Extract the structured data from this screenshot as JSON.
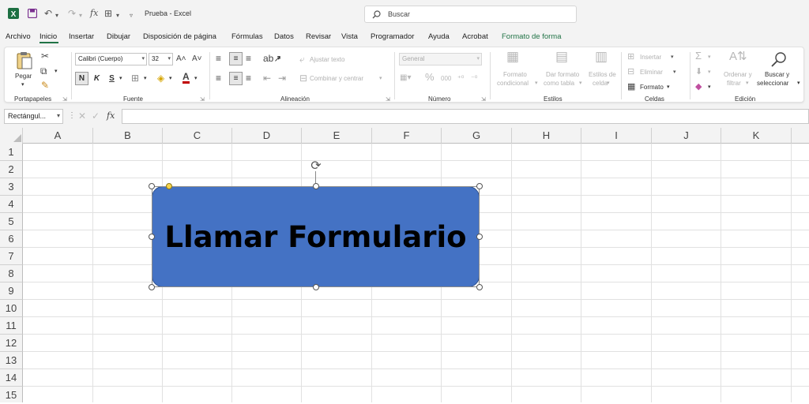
{
  "title_bar": {
    "doc_title": "Prueba  -  Excel",
    "search_placeholder": "Buscar"
  },
  "tabs": [
    "Archivo",
    "Inicio",
    "Insertar",
    "Dibujar",
    "Disposición de página",
    "Fórmulas",
    "Datos",
    "Revisar",
    "Vista",
    "Programador",
    "Ayuda",
    "Acrobat",
    "Formato de forma"
  ],
  "ribbon": {
    "portapapeles": {
      "label": "Portapapeles",
      "pegar": "Pegar"
    },
    "fuente": {
      "label": "Fuente",
      "font": "Calibri (Cuerpo)",
      "size": "32"
    },
    "alineacion": {
      "label": "Alineación",
      "ajustar": "Ajustar texto",
      "combinar": "Combinar y centrar"
    },
    "numero": {
      "label": "Número",
      "format": "General"
    },
    "estilos": {
      "label": "Estilos",
      "cond1": "Formato",
      "cond2": "condicional",
      "tabla1": "Dar formato",
      "tabla2": "como tabla",
      "celda1": "Estilos de",
      "celda2": "celda"
    },
    "celdas": {
      "label": "Celdas",
      "insertar": "Insertar",
      "eliminar": "Eliminar",
      "formato": "Formato"
    },
    "edicion": {
      "label": "Edición",
      "ordenar1": "Ordenar y",
      "ordenar2": "filtrar",
      "buscar1": "Buscar y",
      "buscar2": "seleccionar"
    }
  },
  "formula_bar": {
    "namebox": "Rectángul...",
    "fx": "fx"
  },
  "columns": [
    "A",
    "B",
    "C",
    "D",
    "E",
    "F",
    "G",
    "H",
    "I",
    "J",
    "K"
  ],
  "rows": [
    "1",
    "2",
    "3",
    "4",
    "5",
    "6",
    "7",
    "8",
    "9",
    "10",
    "11",
    "12",
    "13",
    "14",
    "15"
  ],
  "shape": {
    "text": "Llamar Formulario",
    "fill": "#4472c4"
  },
  "colors": {
    "accent": "#217346",
    "excel_green": "#1d6f42",
    "save_purple": "#7a2f8f"
  }
}
